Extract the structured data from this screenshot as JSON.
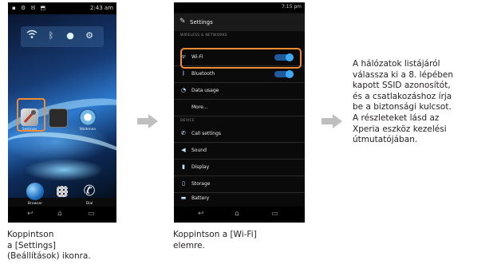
{
  "phone1": {
    "status_time": "2:43 am",
    "apps": [
      {
        "label": "Settings",
        "icon": "settings-icon"
      },
      {
        "label": "",
        "icon": "calendar-icon"
      },
      {
        "label": "Walkman",
        "icon": "walkman-icon"
      }
    ],
    "dock": [
      {
        "label": "Browser",
        "icon": "globe-icon"
      },
      {
        "label": "",
        "icon": "apps-grid-icon"
      },
      {
        "label": "Dial",
        "icon": "phone-icon"
      }
    ]
  },
  "phone2": {
    "status_time": "7:15 pm",
    "title": "Settings",
    "section_wireless": "WIRELESS & NETWORKS",
    "section_device": "DEVICE",
    "wireless_items": [
      {
        "label": "Wi-Fi",
        "icon": "wifi-icon",
        "toggle": true
      },
      {
        "label": "Bluetooth",
        "icon": "bluetooth-icon",
        "toggle": true
      },
      {
        "label": "Data usage",
        "icon": "data-usage-icon",
        "toggle": false
      },
      {
        "label": "More...",
        "icon": "",
        "toggle": false
      }
    ],
    "device_items": [
      {
        "label": "Call settings",
        "icon": "call-icon"
      },
      {
        "label": "Sound",
        "icon": "sound-icon"
      },
      {
        "label": "Display",
        "icon": "display-icon"
      },
      {
        "label": "Storage",
        "icon": "storage-icon"
      },
      {
        "label": "Battery",
        "icon": "battery-icon"
      }
    ]
  },
  "captions": {
    "step1": "Koppintson\na [Settings]\n(Beállítások) ikonra.",
    "step2": "Koppintson a [Wi-Fi]\nelemre.",
    "step3": "A hálózatok listájáról\nválassza ki a 8. lépében\nkapott SSID azonosítót,\nés a csatlakozáshoz írja\nbe a biztonsági kulcsot.\nA részleteket lásd az\nXperia eszköz kezelési\nútmutatójában."
  },
  "colors": {
    "highlight": "#f18c35",
    "arrow": "#bfbfbf",
    "toggle_on": "#3fa9f5"
  }
}
